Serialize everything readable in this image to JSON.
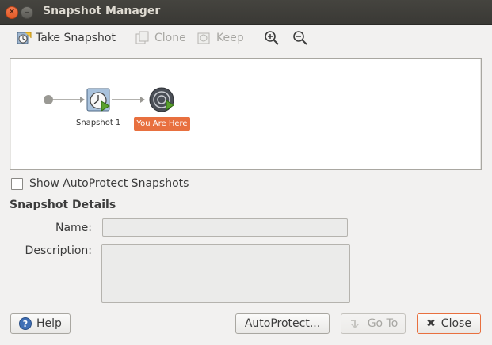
{
  "window": {
    "title": "Snapshot Manager"
  },
  "toolbar": {
    "take_snapshot": "Take Snapshot",
    "clone": "Clone",
    "keep": "Keep",
    "zoom_in_icon": "zoom-in-icon",
    "zoom_out_icon": "zoom-out-icon"
  },
  "tree": {
    "snapshot_label": "Snapshot 1",
    "current_label": "You Are Here"
  },
  "options": {
    "show_autoprotect": "Show AutoProtect Snapshots",
    "show_autoprotect_checked": false
  },
  "details": {
    "heading": "Snapshot Details",
    "name_label": "Name:",
    "name_value": "",
    "description_label": "Description:",
    "description_value": ""
  },
  "buttons": {
    "help": "Help",
    "autoprotect": "AutoProtect...",
    "goto": "Go To",
    "close": "Close"
  },
  "colors": {
    "accent": "#e8703f",
    "title_bar": "#3e3d39"
  }
}
